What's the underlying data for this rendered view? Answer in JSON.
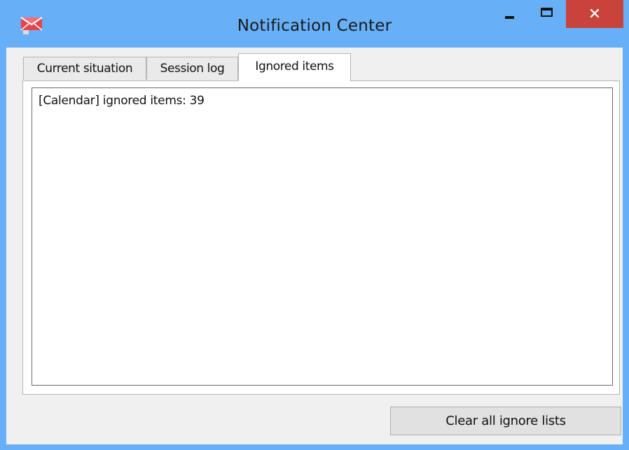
{
  "window": {
    "title": "Notification Center",
    "app_icon": "envelope-x-icon",
    "controls": {
      "minimize": "minimize-icon",
      "maximize": "maximize-icon",
      "close": "close-icon",
      "close_glyph": "✕"
    },
    "accent": "#67b0f8",
    "close_color": "#c7433b"
  },
  "tabs": [
    {
      "label": "Current situation",
      "selected": false
    },
    {
      "label": "Session log",
      "selected": false
    },
    {
      "label": "Ignored items",
      "selected": true
    }
  ],
  "ignored_items": {
    "lines": [
      "[Calendar] ignored items: 39"
    ]
  },
  "footer": {
    "clear_button_label": "Clear all ignore lists"
  }
}
